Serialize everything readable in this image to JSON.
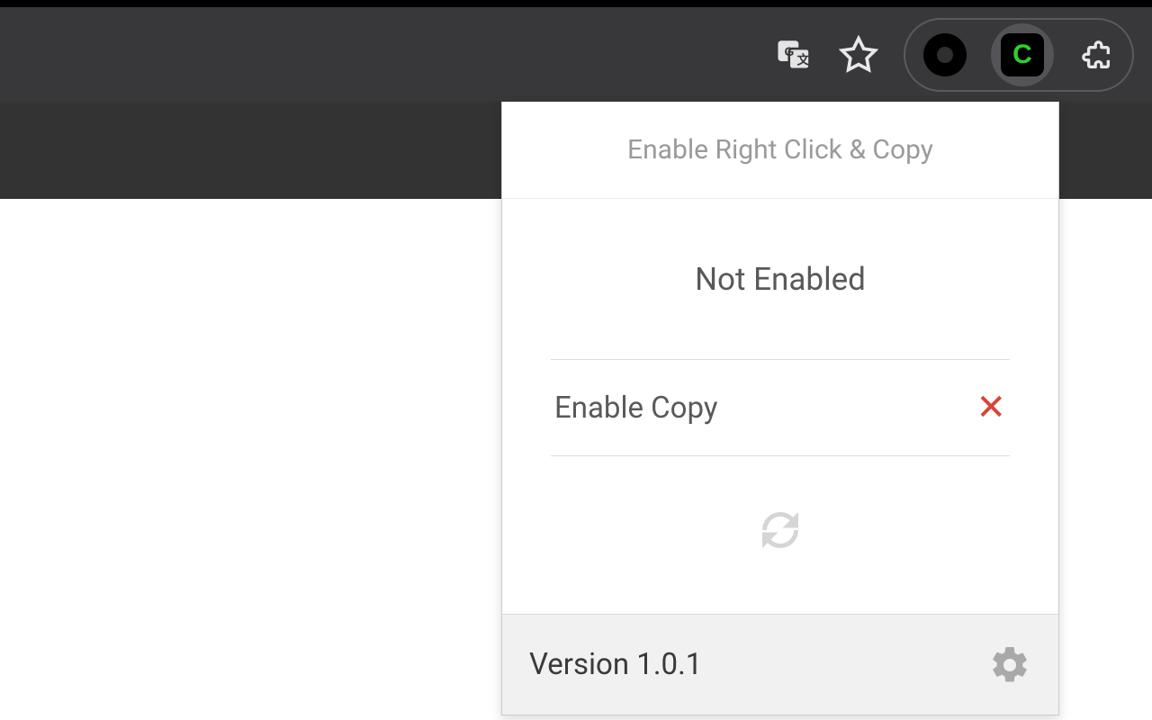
{
  "toolbar": {
    "extension_letter": "C"
  },
  "popup": {
    "title": "Enable Right Click & Copy",
    "status": "Not Enabled",
    "enable_copy_label": "Enable Copy",
    "version_label": "Version 1.0.1"
  }
}
